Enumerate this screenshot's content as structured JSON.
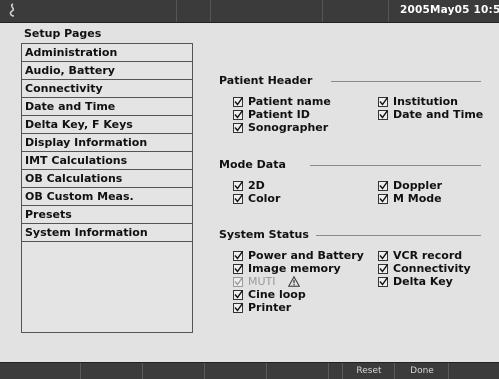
{
  "header": {
    "datetime": "2005May05  10:5"
  },
  "sidebar": {
    "title": "Setup Pages",
    "items": [
      {
        "label": "Administration"
      },
      {
        "label": "Audio, Battery"
      },
      {
        "label": "Connectivity"
      },
      {
        "label": "Date and Time"
      },
      {
        "label": "Delta Key, F Keys"
      },
      {
        "label": "Display Information"
      },
      {
        "label": "IMT Calculations"
      },
      {
        "label": "OB Calculations"
      },
      {
        "label": "OB Custom Meas."
      },
      {
        "label": "Presets"
      },
      {
        "label": "System Information"
      }
    ]
  },
  "patient_header": {
    "title": "Patient Header",
    "options": [
      {
        "label": "Patient name",
        "checked": true
      },
      {
        "label": "Institution",
        "checked": true
      },
      {
        "label": "Patient ID",
        "checked": true
      },
      {
        "label": "Date and Time",
        "checked": true
      },
      {
        "label": "Sonographer",
        "checked": true
      }
    ]
  },
  "mode_data": {
    "title": "Mode Data",
    "options": [
      {
        "label": "2D",
        "checked": true
      },
      {
        "label": "Doppler",
        "checked": true
      },
      {
        "label": "Color",
        "checked": true
      },
      {
        "label": "M Mode",
        "checked": true
      }
    ]
  },
  "system_status": {
    "title": "System Status",
    "options": [
      {
        "label": "Power and Battery",
        "checked": true
      },
      {
        "label": "VCR record",
        "checked": true
      },
      {
        "label": "Image memory",
        "checked": true
      },
      {
        "label": "Connectivity",
        "checked": true
      },
      {
        "label": "MUTI",
        "checked": true,
        "disabled": true,
        "icon": "warning-icon"
      },
      {
        "label": "Delta Key",
        "checked": true
      },
      {
        "label": "Cine loop",
        "checked": true
      },
      {
        "label": "Printer",
        "checked": true
      }
    ]
  },
  "softkeys": [
    {
      "label": ""
    },
    {
      "label": ""
    },
    {
      "label": ""
    },
    {
      "label": ""
    },
    {
      "label": ""
    },
    {
      "label": "Reset"
    },
    {
      "label": "Done"
    }
  ]
}
